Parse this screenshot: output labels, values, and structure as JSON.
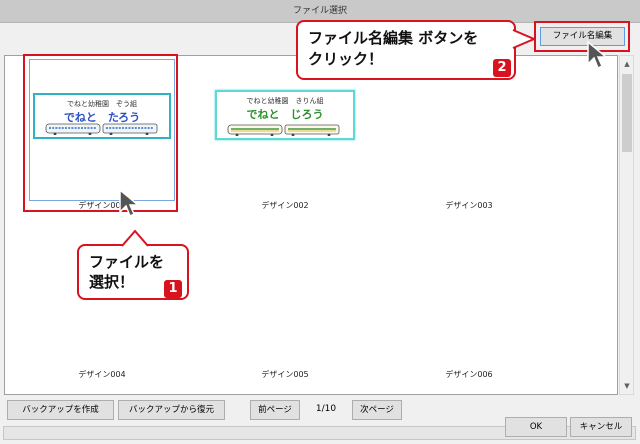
{
  "window": {
    "title": "ファイル選択"
  },
  "toolbar": {
    "rename_button": "ファイル名編集"
  },
  "tiles": [
    {
      "label": "デザイン001",
      "line1": "でねと幼稚園　ぞう組",
      "line2": "でねと　たろう",
      "name_color": "#2d4fc4",
      "selected": true
    },
    {
      "label": "デザイン002",
      "line1": "でねと幼稚園　きりん組",
      "line2": "でねと　じろう",
      "name_color": "#2f8f2f",
      "selected": false
    },
    {
      "label": "デザイン003"
    },
    {
      "label": "デザイン004"
    },
    {
      "label": "デザイン005"
    },
    {
      "label": "デザイン006"
    }
  ],
  "callouts": {
    "select": {
      "text_line1": "ファイルを",
      "text_line2": "選択！",
      "badge": "1"
    },
    "rename": {
      "text_line1": "ファイル名編集 ボタンを",
      "text_line2": "クリック！",
      "badge": "2"
    }
  },
  "bottom": {
    "backup_button": "バックアップを作成",
    "restore_button": "バックアップから復元",
    "prev_button": "前ページ",
    "page_indicator": "1/10",
    "next_button": "次ページ",
    "ok_button": "OK",
    "cancel_button": "キャンセル"
  },
  "colors": {
    "accent_red": "#d9121f",
    "tile_border": "#2db3c3"
  }
}
